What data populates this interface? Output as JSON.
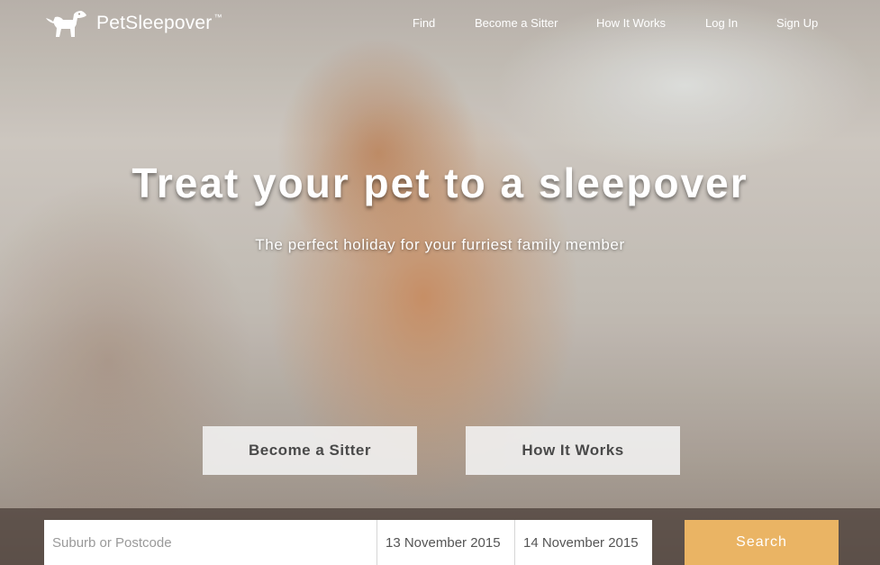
{
  "brand": {
    "name": "PetSleepover",
    "trademark": "™",
    "icon": "dog-icon"
  },
  "nav": {
    "items": [
      {
        "label": "Find"
      },
      {
        "label": "Become a Sitter"
      },
      {
        "label": "How It Works"
      },
      {
        "label": "Log In"
      },
      {
        "label": "Sign Up"
      }
    ]
  },
  "hero": {
    "title": "Treat your pet to a sleepover",
    "subtitle": "The perfect holiday for your furriest family member",
    "buttons": {
      "become_sitter": "Become a Sitter",
      "how_it_works": "How It Works"
    }
  },
  "search": {
    "location_placeholder": "Suburb or Postcode",
    "start_date": "13 November 2015",
    "end_date": "14 November 2015",
    "button_label": "Search"
  },
  "colors": {
    "search_button": "#eab464",
    "text_light": "#ffffff",
    "button_text": "#4a4a4a"
  }
}
